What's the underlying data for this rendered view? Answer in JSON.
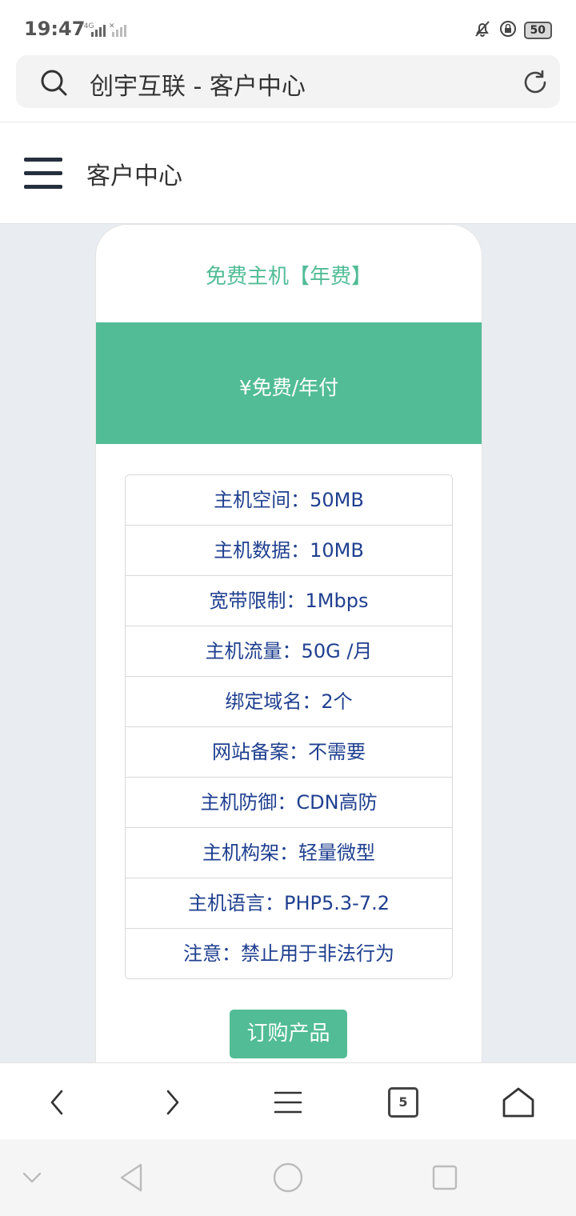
{
  "status_bar": {
    "time": "19:47",
    "network": "4G",
    "battery": "50"
  },
  "url_bar": {
    "title": "创宇互联 - 客户中心"
  },
  "page_header": {
    "title": "客户中心"
  },
  "product": {
    "name": "免费主机【年费】",
    "price": "¥免费/年付",
    "features": [
      "主机空间：50MB",
      "主机数据：10MB",
      "宽带限制：1Mbps",
      "主机流量：50G /月",
      "绑定域名：2个",
      "网站备案：不需要",
      "主机防御：CDN高防",
      "主机构架：轻量微型",
      "主机语言：PHP5.3-7.2",
      "注意：禁止用于非法行为"
    ],
    "order_button": "订购产品"
  },
  "browser_toolbar": {
    "tab_count": "5",
    "icons": [
      "back-icon",
      "forward-icon",
      "menu-icon",
      "tabs-icon",
      "home-icon"
    ]
  },
  "system_nav": {
    "icons": [
      "collapse-icon",
      "back-triangle-icon",
      "home-circle-icon",
      "recents-square-icon"
    ]
  },
  "colors": {
    "accent": "#52bc96",
    "feature_text": "#1f3f8f",
    "page_bg": "#e9edf1"
  }
}
